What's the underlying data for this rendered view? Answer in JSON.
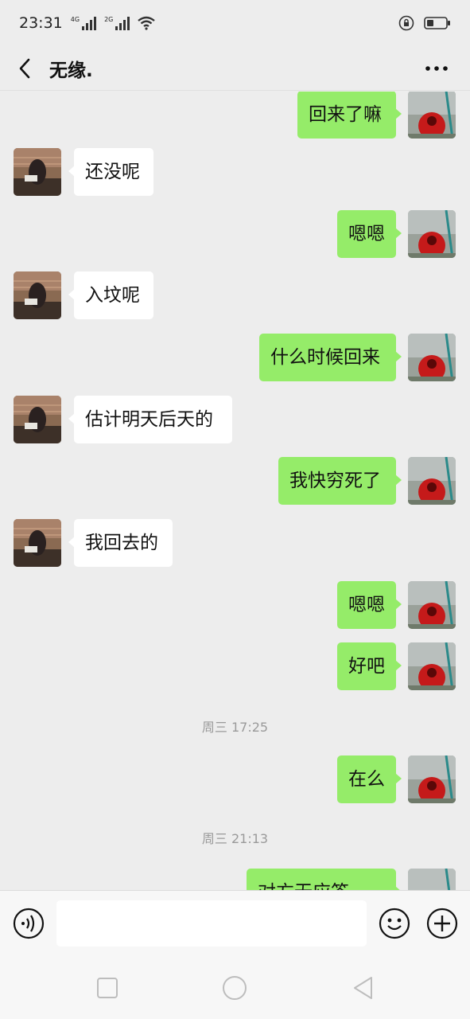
{
  "status": {
    "time": "23:31",
    "net1": "4G",
    "net2": "2G"
  },
  "header": {
    "title": "无缘.",
    "back": "back-icon",
    "more": "more-dots-icon"
  },
  "colors": {
    "sent_bubble": "#95ec69",
    "received_bubble": "#ffffff",
    "background": "#ededed"
  },
  "messages": [
    {
      "from": "me",
      "text": "回来了嘛"
    },
    {
      "from": "friend",
      "text": "还没呢"
    },
    {
      "from": "me",
      "text": "嗯嗯"
    },
    {
      "from": "friend",
      "text": "入坟呢"
    },
    {
      "from": "me",
      "text": "什么时候回来"
    },
    {
      "from": "friend",
      "text": "估计明天后天的"
    },
    {
      "from": "me",
      "text": "我快穷死了"
    },
    {
      "from": "friend",
      "text": "我回去的"
    },
    {
      "from": "me",
      "text": "嗯嗯"
    },
    {
      "from": "me",
      "text": "好吧"
    },
    {
      "time": "周三 17:25"
    },
    {
      "from": "me",
      "text": "在么"
    },
    {
      "time": "周三 21:13"
    },
    {
      "from": "me",
      "text": "对方无应答"
    }
  ],
  "input": {
    "voice": "voice-icon",
    "emoji": "emoji-icon",
    "add": "plus-icon",
    "value": ""
  },
  "nav": {
    "recent": "square-icon",
    "home": "circle-icon",
    "back": "triangle-back-icon"
  }
}
